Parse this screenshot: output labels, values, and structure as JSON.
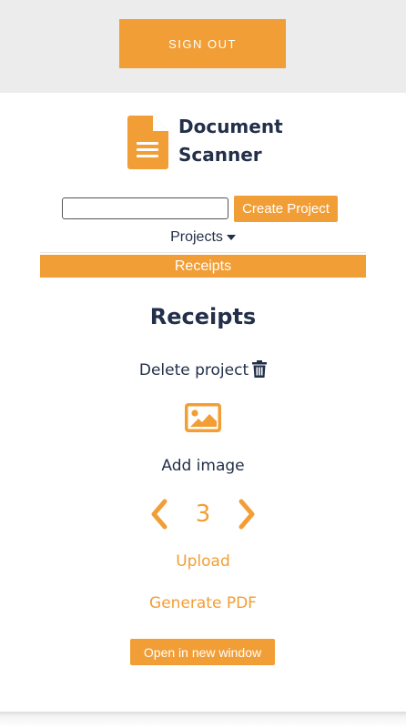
{
  "topbar": {
    "sign_out_label": "SIGN OUT"
  },
  "brand": {
    "name_line1": "Document",
    "name_line2": "Scanner",
    "logo_icon": "document-icon"
  },
  "create_project": {
    "input_value": "",
    "button_label": "Create Project"
  },
  "projects": {
    "toggle_label": "Projects",
    "items": [
      {
        "label": "Receipts",
        "selected": true
      }
    ]
  },
  "project_view": {
    "title": "Receipts",
    "delete_label": "Delete project",
    "delete_icon": "trash-icon",
    "add_image_icon": "image-icon",
    "add_image_label": "Add image",
    "page_number": "3",
    "upload_label": "Upload",
    "generate_pdf_label": "Generate PDF",
    "open_window_label": "Open in new window"
  },
  "colors": {
    "accent": "#f29e36",
    "text": "#23304a",
    "topbar_bg": "#ececec"
  }
}
